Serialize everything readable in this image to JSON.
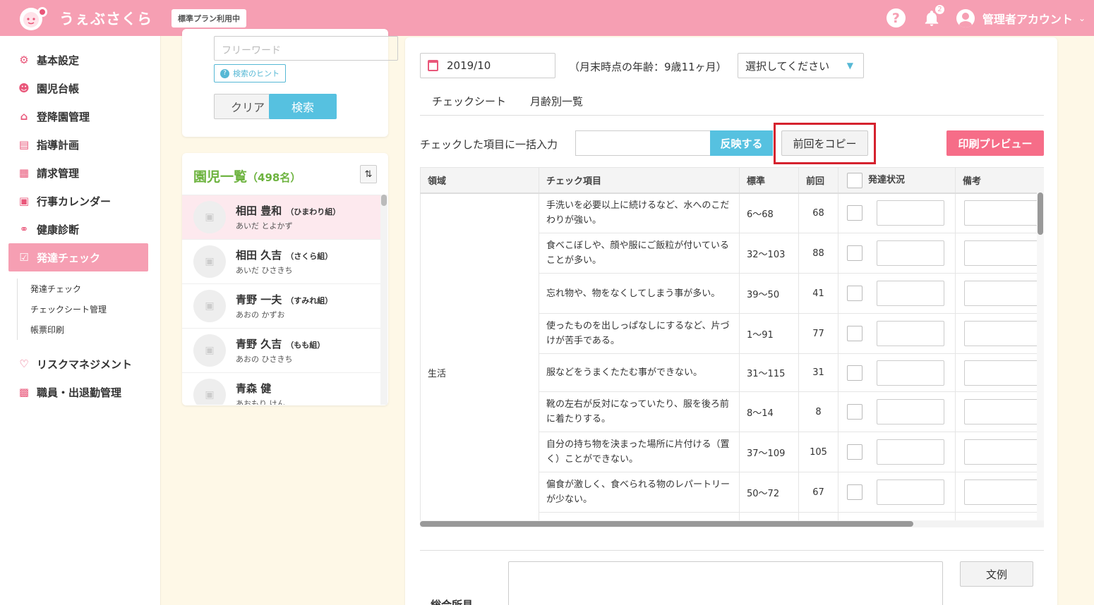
{
  "header": {
    "logo_text": "うぇぶさくら",
    "plan_badge": "標準プラン利用中",
    "notification_count": "2",
    "account_name": "管理者アカウント",
    "brand_color": "#f69fb3"
  },
  "sidebar": {
    "items": [
      {
        "label": "基本設定",
        "icon": "gear-icon"
      },
      {
        "label": "園児台帳",
        "icon": "child-face-icon"
      },
      {
        "label": "登降園管理",
        "icon": "school-icon"
      },
      {
        "label": "指導計画",
        "icon": "notebook-icon"
      },
      {
        "label": "請求管理",
        "icon": "calculator-icon"
      },
      {
        "label": "行事カレンダー",
        "icon": "calendar-icon"
      },
      {
        "label": "健康診断",
        "icon": "stethoscope-icon"
      },
      {
        "label": "発達チェック",
        "icon": "checklist-icon",
        "active": true
      }
    ],
    "sub_items": [
      "発達チェック",
      "チェックシート管理",
      "帳票印刷"
    ],
    "items_after": [
      {
        "label": "リスクマネジメント",
        "icon": "heart-hands-icon"
      },
      {
        "label": "職員・出退勤管理",
        "icon": "briefcase-icon"
      }
    ]
  },
  "search": {
    "placeholder": "フリーワード",
    "hint_label": "検索のヒント",
    "clear_label": "クリア",
    "search_label": "検索"
  },
  "children": {
    "title": "園児一覧",
    "count": "（498名）",
    "list": [
      {
        "name": "相田 豊和",
        "class": "（ひまわり組）",
        "kana": "あいだ とよかず",
        "selected": true
      },
      {
        "name": "相田 久吉",
        "class": "（さくら組）",
        "kana": "あいだ ひさきち"
      },
      {
        "name": "青野 一夫",
        "class": "（すみれ組）",
        "kana": "あおの かずお"
      },
      {
        "name": "青野 久吉",
        "class": "（もも組）",
        "kana": "あおの ひさきち"
      },
      {
        "name": "青森 健",
        "class": "",
        "kana": "あおもり けん"
      }
    ]
  },
  "check": {
    "date": "2019/10",
    "age_text": "（月末時点の年齢：9歳11ヶ月）",
    "select_placeholder": "選択してください",
    "tabs": [
      "チェックシート",
      "月齢別一覧"
    ],
    "bulk_label": "チェックした項目に一括入力",
    "reflect_label": "反映する",
    "copy_label": "前回をコピー",
    "print_label": "印刷プレビュー",
    "columns": [
      "領域",
      "チェック項目",
      "標準",
      "前回",
      "発達状況",
      "備考"
    ],
    "domain": "生活",
    "rows": [
      {
        "item": "手洗いを必要以上に続けるなど、水へのこだわりが強い。",
        "std": "6〜68",
        "prev": "68"
      },
      {
        "item": "食べこぼしや、顔や服にご飯粒が付いていることが多い。",
        "std": "32〜103",
        "prev": "88"
      },
      {
        "item": "忘れ物や、物をなくしてしまう事が多い。",
        "std": "39〜50",
        "prev": "41"
      },
      {
        "item": "使ったものを出しっぱなしにするなど、片づけが苦手である。",
        "std": "1〜91",
        "prev": "77"
      },
      {
        "item": "服などをうまくたたむ事ができない。",
        "std": "31〜115",
        "prev": "31"
      },
      {
        "item": "靴の左右が反対になっていたり、服を後ろ前に着たりする。",
        "std": "8〜14",
        "prev": "8"
      },
      {
        "item": "自分の持ち物を決まった場所に片付ける（置く）ことができない。",
        "std": "37〜109",
        "prev": "105"
      },
      {
        "item": "偏食が激しく、食べられる物のレパートリーが少ない。",
        "std": "50〜72",
        "prev": "67"
      }
    ],
    "overall_label": "総合所見",
    "example_label": "文例"
  }
}
